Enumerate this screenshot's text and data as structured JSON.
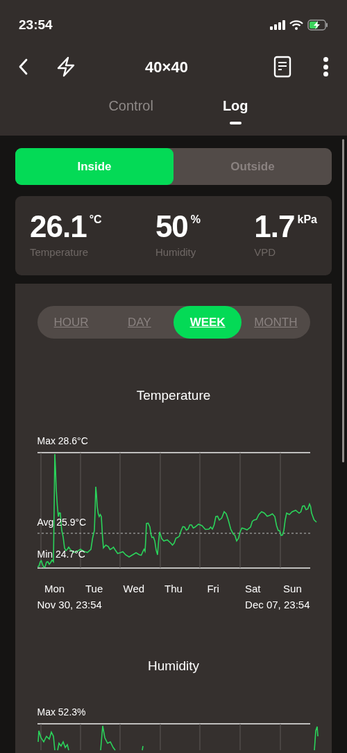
{
  "status_bar": {
    "time": "23:54"
  },
  "header": {
    "title": "40×40"
  },
  "tabs": [
    {
      "label": "Control",
      "selected": false
    },
    {
      "label": "Log",
      "selected": true
    }
  ],
  "location_toggle": [
    {
      "label": "Inside",
      "selected": true
    },
    {
      "label": "Outside",
      "selected": false
    }
  ],
  "readings": [
    {
      "value": "26.1",
      "unit": "°C",
      "label": "Temperature"
    },
    {
      "value": "50",
      "unit": "%",
      "label": "Humidity"
    },
    {
      "value": "1.7",
      "unit": "kPa",
      "label": "VPD"
    }
  ],
  "periods": [
    {
      "label": "HOUR",
      "selected": false
    },
    {
      "label": "DAY",
      "selected": false
    },
    {
      "label": "WEEK",
      "selected": true
    },
    {
      "label": "MONTH",
      "selected": false
    }
  ],
  "charts": [
    {
      "title": "Temperature",
      "max_label": "Max 28.6°C",
      "avg_label": "Avg 25.9°C",
      "min_label": "Min 24.7°C",
      "days": [
        "Mon",
        "Tue",
        "Wed",
        "Thu",
        "Fri",
        "Sat",
        "Sun"
      ],
      "start": "Nov 30, 23:54",
      "end": "Dec 07, 23:54"
    },
    {
      "title": "Humidity",
      "max_label": "Max 52.3%"
    }
  ]
}
